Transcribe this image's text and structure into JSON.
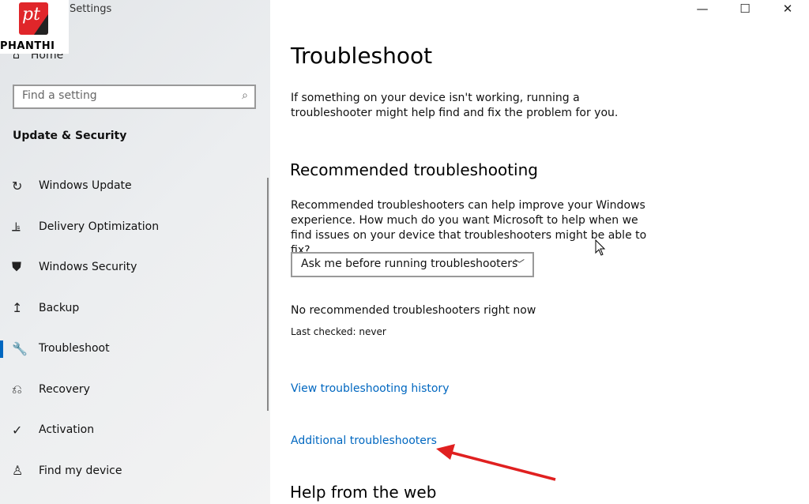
{
  "logo": {
    "brand": "PHANTHI",
    "mark": "pt"
  },
  "window": {
    "title": "Settings",
    "minimize": "—",
    "maximize": "☐",
    "close": "✕"
  },
  "sidebar": {
    "home": "Home",
    "search_placeholder": "Find a setting",
    "section": "Update & Security",
    "items": [
      {
        "label": "Windows Update",
        "icon": "refresh-icon",
        "glyph": "↻"
      },
      {
        "label": "Delivery Optimization",
        "icon": "delivery-icon",
        "glyph": "⫡"
      },
      {
        "label": "Windows Security",
        "icon": "shield-icon",
        "glyph": "⛊"
      },
      {
        "label": "Backup",
        "icon": "backup-icon",
        "glyph": "↥"
      },
      {
        "label": "Troubleshoot",
        "icon": "wrench-icon",
        "glyph": "🔧",
        "active": true
      },
      {
        "label": "Recovery",
        "icon": "recovery-icon",
        "glyph": "⎌"
      },
      {
        "label": "Activation",
        "icon": "check-circle-icon",
        "glyph": "✓"
      },
      {
        "label": "Find my device",
        "icon": "find-device-icon",
        "glyph": "♙"
      }
    ]
  },
  "main": {
    "title": "Troubleshoot",
    "intro": "If something on your device isn't working, running a troubleshooter might help find and fix the problem for you.",
    "recommended_heading": "Recommended troubleshooting",
    "recommended_text": "Recommended troubleshooters can help improve your Windows experience. How much do you want Microsoft to help when we find issues on your device that troubleshooters might be able to fix?",
    "dropdown_value": "Ask me before running troubleshooters",
    "none_text": "No recommended troubleshooters right now",
    "last_checked": "Last checked: never",
    "history_link": "View troubleshooting history",
    "additional_link": "Additional troubleshooters",
    "help_heading": "Help from the web"
  },
  "colors": {
    "accent": "#0067c0",
    "arrow": "#e02020"
  }
}
